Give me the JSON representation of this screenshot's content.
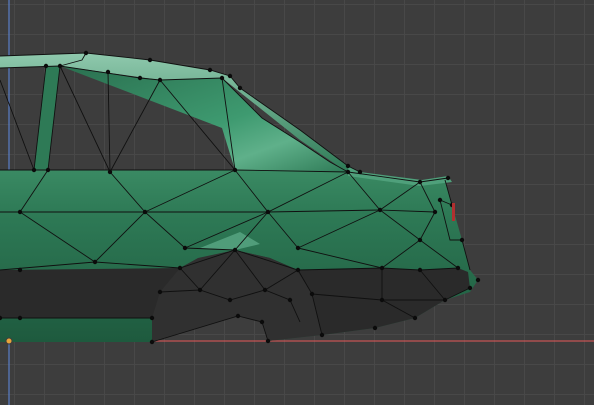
{
  "viewport": {
    "mode": "edit",
    "view": "side-orthographic",
    "grid": true
  },
  "object": {
    "type": "car-mesh",
    "colors": {
      "body": "#2e7a56",
      "body_highlight": "#5aa884",
      "body_shadow": "#1c4f37",
      "tire_band": "#2a2a2a",
      "wheel_arch": "#2f2f2f",
      "wire": "#101010",
      "vertex": "#0b0b0b"
    }
  },
  "axes": {
    "x_axis_color": "#c45454",
    "z_axis_color": "#5a7fc7"
  },
  "origin": {
    "color": "#e8a33b"
  }
}
